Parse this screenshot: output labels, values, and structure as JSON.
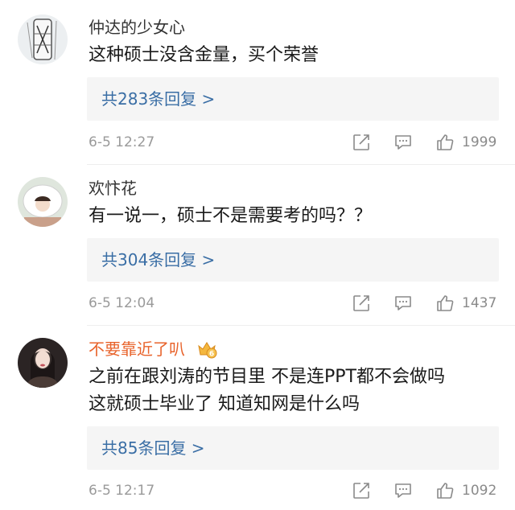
{
  "comments": [
    {
      "username": "仲达的少女心",
      "username_color": "#333333",
      "has_badge": false,
      "avatar_icon": "sketch-figure-avatar",
      "lines": [
        "这种硕士没含金量，买个荣誉"
      ],
      "reply_link": "共283条回复 >",
      "timestamp": "6-5 12:27",
      "likes": "1999"
    },
    {
      "username": "欢忭花",
      "username_color": "#333333",
      "has_badge": false,
      "avatar_icon": "white-hat-person-avatar",
      "lines": [
        "有一说一，硕士不是需要考的吗？？"
      ],
      "reply_link": "共304条回复 >",
      "timestamp": "6-5 12:04",
      "likes": "1437"
    },
    {
      "username": "不要靠近了叭",
      "username_color": "#e8632b",
      "has_badge": true,
      "badge_icon": "member-crown-badge-icon",
      "avatar_icon": "dark-haired-girl-avatar",
      "lines": [
        "之前在跟刘涛的节目里 不是连PPT都不会做吗",
        "这就硕士毕业了 知道知网是什么吗"
      ],
      "reply_link": "共85条回复 >",
      "timestamp": "6-5 12:17",
      "likes": "1092"
    }
  ],
  "action_icons": [
    "share-icon",
    "comment-icon",
    "like-icon"
  ],
  "colors": {
    "link": "#3a6ea5",
    "meta": "#9a9a9a",
    "vip_name": "#e8632b",
    "reply_bg": "#f5f5f5"
  }
}
